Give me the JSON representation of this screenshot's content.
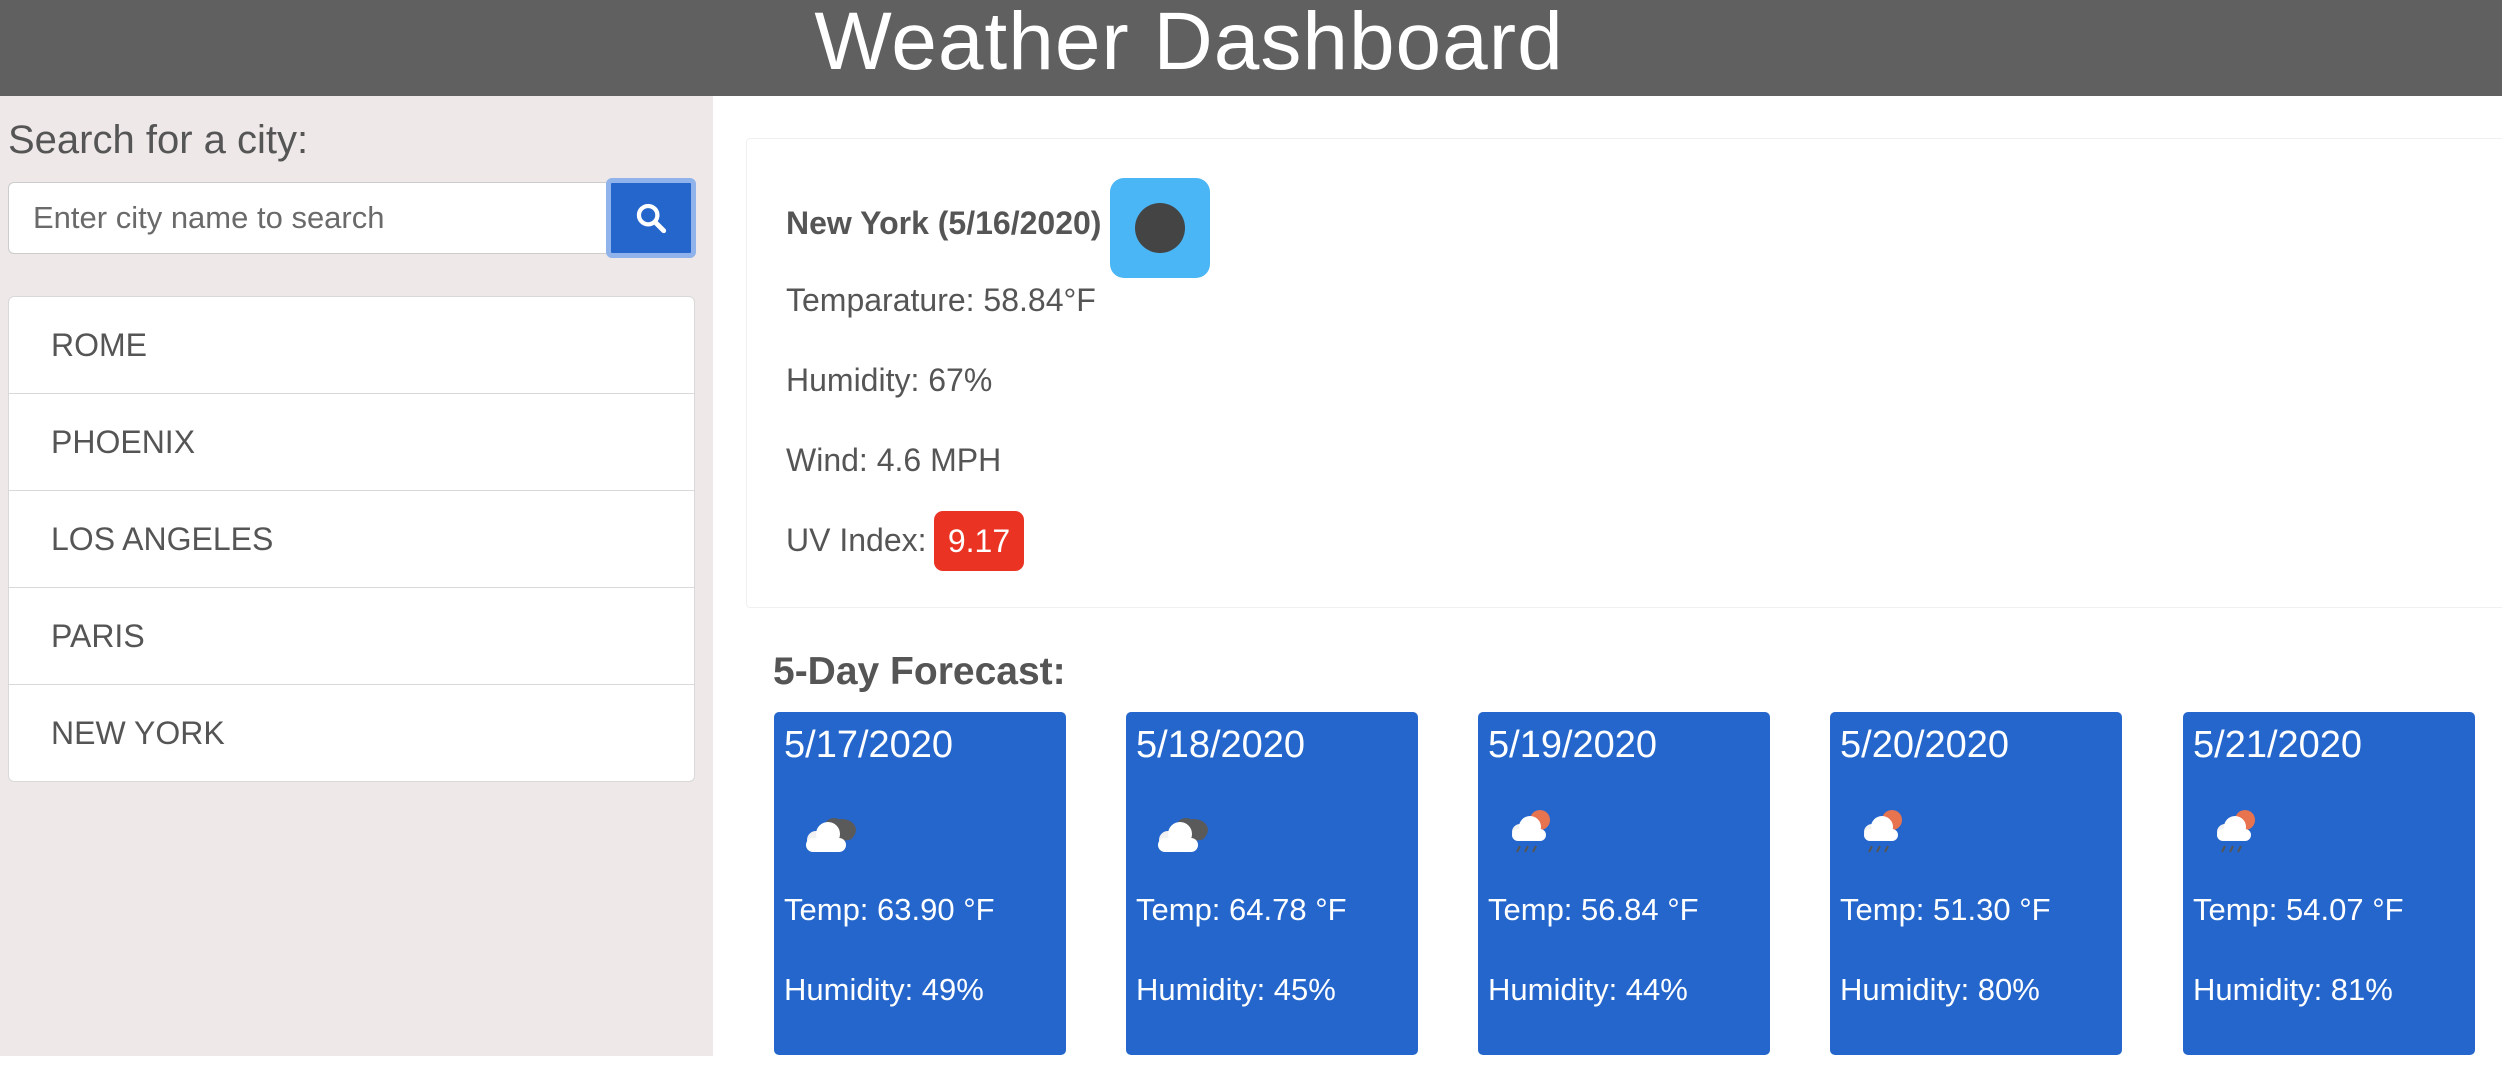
{
  "header": {
    "title": "Weather Dashboard"
  },
  "search": {
    "label": "Search for a city:",
    "placeholder": "Enter city name to search",
    "value": ""
  },
  "history": [
    "ROME",
    "PHOENIX",
    "LOS ANGELES",
    "PARIS",
    "NEW YORK"
  ],
  "current": {
    "title": "New York (5/16/2020)",
    "icon": "clear-night-icon",
    "temperature": "Temparature: 58.84°F",
    "humidity": "Humidity: 67%",
    "wind": "Wind: 4.6 MPH",
    "uv_label": "UV Index:",
    "uv_value": "9.17"
  },
  "forecast": {
    "title": "5-Day Forecast:",
    "days": [
      {
        "date": "5/17/2020",
        "icon": "broken-clouds-icon",
        "temp": "Temp: 63.90 °F",
        "humidity": "Humidity: 49%"
      },
      {
        "date": "5/18/2020",
        "icon": "broken-clouds-icon",
        "temp": "Temp: 64.78 °F",
        "humidity": "Humidity: 45%"
      },
      {
        "date": "5/19/2020",
        "icon": "light-rain-icon",
        "temp": "Temp: 56.84 °F",
        "humidity": "Humidity: 44%"
      },
      {
        "date": "5/20/2020",
        "icon": "light-rain-icon",
        "temp": "Temp: 51.30 °F",
        "humidity": "Humidity: 80%"
      },
      {
        "date": "5/21/2020",
        "icon": "light-rain-icon",
        "temp": "Temp: 54.07 °F",
        "humidity": "Humidity: 81%"
      }
    ]
  },
  "colors": {
    "header": "#5f605f",
    "sidebar": "#eee8e8",
    "accent": "#2466cc",
    "uv_high": "#ea3323",
    "icon_sky": "#4ab6f5"
  }
}
